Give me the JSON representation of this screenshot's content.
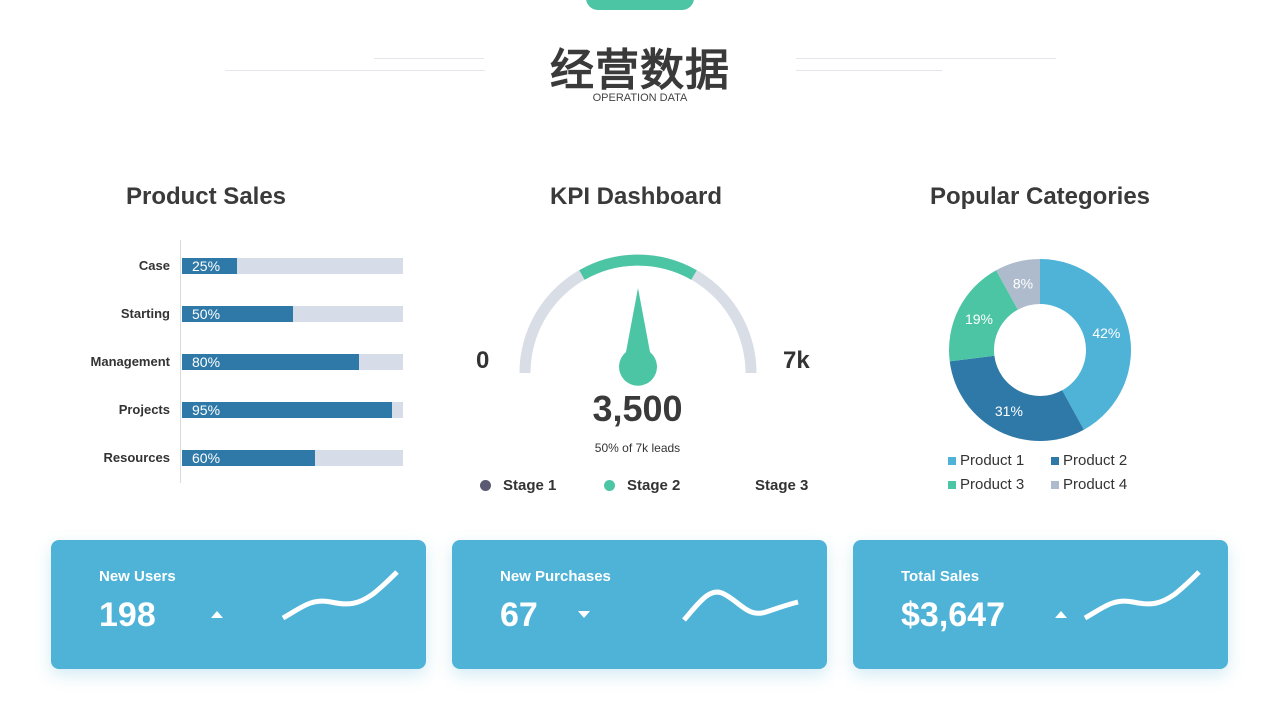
{
  "header": {
    "title": "经营数据",
    "subtitle": "OPERATION DATA"
  },
  "product_sales": {
    "title": "Product Sales",
    "items": [
      {
        "label": "Case",
        "percent_text": "25%",
        "value": 25
      },
      {
        "label": "Starting",
        "percent_text": "50%",
        "value": 50
      },
      {
        "label": "Management",
        "percent_text": "80%",
        "value": 80
      },
      {
        "label": "Projects",
        "percent_text": "95%",
        "value": 95
      },
      {
        "label": "Resources",
        "percent_text": "60%",
        "value": 60
      }
    ]
  },
  "kpi": {
    "title": "KPI Dashboard",
    "min_label": "0",
    "max_label": "7k",
    "value_text": "3,500",
    "value": 3500,
    "max": 7000,
    "caption": "50% of 7k leads",
    "stages": [
      {
        "label": "Stage 1",
        "color": "#5a5a72"
      },
      {
        "label": "Stage 2",
        "color": "#4cc5a4"
      },
      {
        "label": "Stage 3",
        "color": null
      }
    ]
  },
  "categories": {
    "title": "Popular Categories",
    "legend": [
      {
        "label": "Product  1",
        "color": "#4fb3d8"
      },
      {
        "label": "Product  2",
        "color": "#2e79a8"
      },
      {
        "label": "Product  3",
        "color": "#4cc5a4"
      },
      {
        "label": "Product  4",
        "color": "#aebbcc"
      }
    ]
  },
  "chart_data": {
    "type": "pie",
    "title": "Popular Categories",
    "categories": [
      "Product 1",
      "Product 2",
      "Product 3",
      "Product 4"
    ],
    "values": [
      42,
      31,
      19,
      8
    ],
    "labels": [
      "42%",
      "31%",
      "19%",
      "8%"
    ],
    "colors": [
      "#4fb3d8",
      "#2e79a8",
      "#4cc5a4",
      "#aebbcc"
    ]
  },
  "cards": [
    {
      "label": "New Users",
      "value": "198",
      "trend": "up"
    },
    {
      "label": "New Purchases",
      "value": "67",
      "trend": "down"
    },
    {
      "label": "Total Sales",
      "value": "$3,647",
      "trend": "up"
    }
  ],
  "colors": {
    "accent_teal": "#4cc5a4",
    "bar_blue": "#2e79a8",
    "card_blue": "#4fb3d8",
    "track_gray": "#d6dde8"
  }
}
